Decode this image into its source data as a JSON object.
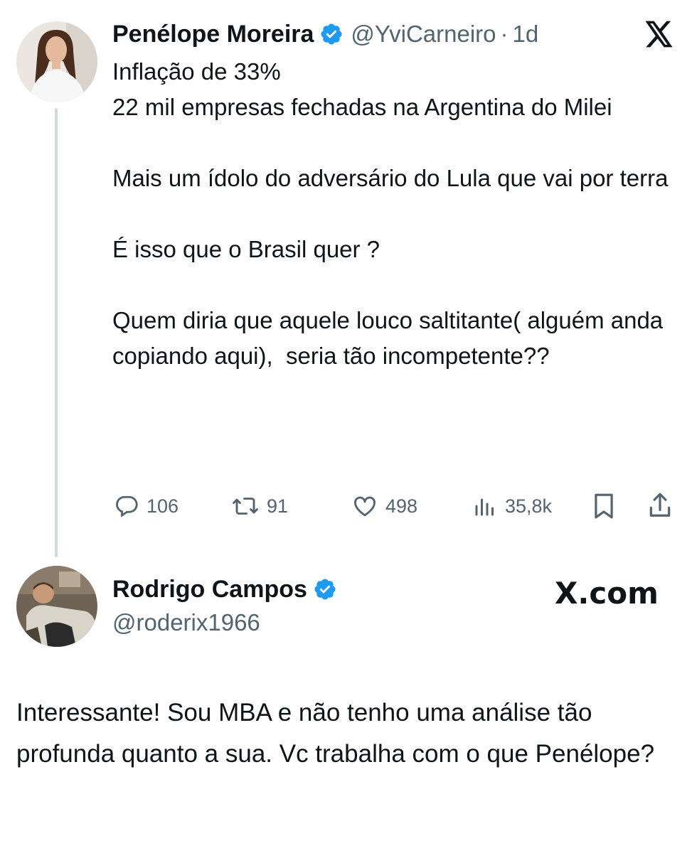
{
  "original_tweet": {
    "author_name": "Penélope Moreira",
    "handle": "@YviCarneiro",
    "separator": "·",
    "time": "1d",
    "text": "Inflação de 33%\n22 mil empresas fechadas na Argentina do Milei\n\nMais um ídolo do adversário do Lula que vai por terra\n\nÉ isso que o Brasil quer ?\n\nQuem diria que aquele louco saltitante( alguém anda copiando aqui),  seria tão incompetente??",
    "stats": {
      "replies": "106",
      "reposts": "91",
      "likes": "498",
      "views": "35,8k"
    }
  },
  "reply_tweet": {
    "author_name": "Rodrigo Campos",
    "handle": "@roderix1966",
    "text": "Interessante! Sou MBA e não tenho uma análise tão profunda quanto a sua. Vc trabalha com o que Penélope?"
  },
  "watermark": {
    "text": "X.com"
  },
  "icons": [
    "x-logo-icon",
    "verified-badge-icon",
    "reply-icon",
    "repost-icon",
    "like-icon",
    "views-icon",
    "bookmark-icon",
    "share-icon"
  ],
  "colors": {
    "verified": "#1d9bf0",
    "secondary_text": "#536471",
    "thread_line": "#cfd9de"
  }
}
